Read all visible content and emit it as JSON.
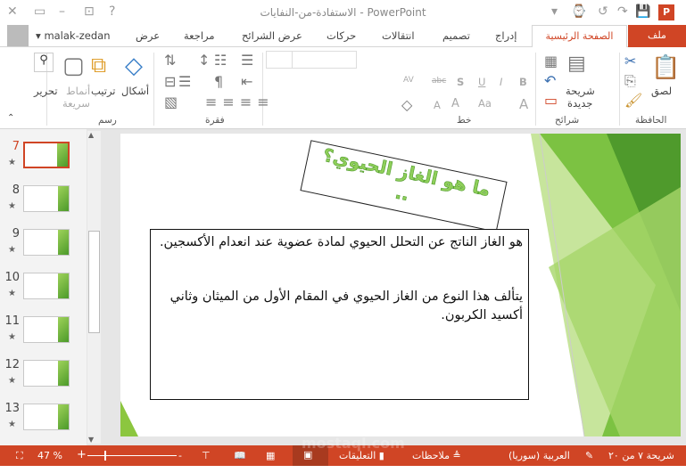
{
  "window": {
    "title": "الاستفادة-من-النفايات - PowerPoint"
  },
  "tabs": {
    "file": "ملف",
    "home": "الصفحة الرئيسية",
    "insert": "إدراج",
    "design": "تصميم",
    "transitions": "انتقالات",
    "animations": "حركات",
    "slideshow": "عرض الشرائح",
    "review": "مراجعة",
    "view": "عرض",
    "user": "malak-zedan"
  },
  "ribbon": {
    "clipboard": {
      "label": "الحافظة",
      "paste": "لصق"
    },
    "slides": {
      "label": "شرائح",
      "new_slide_1": "شريحة",
      "new_slide_2": "جديدة"
    },
    "font": {
      "label": "خط",
      "bold": "B",
      "italic": "I",
      "underline": "U",
      "shadow": "S",
      "strike": "abc",
      "spacing": "AV",
      "aa": "Aa",
      "grow": "A",
      "shrink": "A",
      "clear": "A"
    },
    "paragraph": {
      "label": "فقرة"
    },
    "drawing": {
      "label": "رسم",
      "shapes": "أشكال",
      "arrange": "ترتيب",
      "quick_styles_1": "أنماط",
      "quick_styles_2": "سريعة"
    },
    "editing": {
      "label": "تحرير"
    }
  },
  "thumbnails": [
    {
      "n": "7",
      "active": true
    },
    {
      "n": "8"
    },
    {
      "n": "9"
    },
    {
      "n": "10"
    },
    {
      "n": "11"
    },
    {
      "n": "12"
    },
    {
      "n": "13"
    }
  ],
  "slide": {
    "title": "ما هو الغاز الحيوي؟",
    "title_dots": "..",
    "para1": "هو الغاز الناتج عن التحلل الحيوي لمادة عضوية عند انعدام الأكسجين.",
    "para2": "يتألف هذا النوع من الغاز الحيوي في المقام الأول من الميثان وثاني أكسيد الكربون."
  },
  "status": {
    "slide_of": "شريحة ٧ من ٢٠",
    "language": "العربية (سوريا)",
    "notes": "ملاحظات",
    "comments": "التعليقات",
    "zoom": "47 %",
    "watermark": "mostaql.com"
  },
  "colors": {
    "accent": "#d04525",
    "green": "#8fcf5a"
  }
}
